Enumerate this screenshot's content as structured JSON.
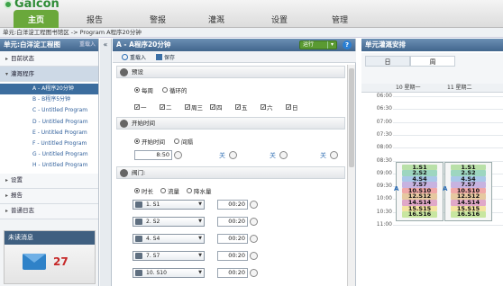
{
  "app": {
    "logo": "Galcon",
    "breadcrumb": "单元:白洋淀工程图书馆区 -> Program A程序20分钟"
  },
  "nav": [
    "主页",
    "报告",
    "警报",
    "灌溉",
    "设置",
    "管理"
  ],
  "sidebar": {
    "title": "单元:白洋淀工程图",
    "title_action": "重载入",
    "items_top": [
      {
        "label": "目前状态"
      },
      {
        "label": "灌溉程序"
      }
    ],
    "programs": [
      "A - A程序20分钟",
      "B - B程序5分钟",
      "C - Untitled Program",
      "D - Untitled Program",
      "E - Untitled Program",
      "F - Untitled Program",
      "G - Untitled Program",
      "H - Untitled Program"
    ],
    "items_bottom": [
      {
        "label": "设置"
      },
      {
        "label": "报告"
      },
      {
        "label": "普通日志"
      }
    ],
    "messages_title": "未读消息",
    "messages_count": "27"
  },
  "collapse": "«",
  "program": {
    "title": "A - A程序20分钟",
    "run_label": "运行",
    "reload": "重载入",
    "save": "保存",
    "schedule_title": "预设",
    "every_week": "每周",
    "cyclic": "循环的",
    "days": [
      "一",
      "二",
      "周三",
      "四",
      "五",
      "六",
      "日"
    ],
    "start_title": "开始时间",
    "start_time_opt": "开始时间",
    "interval_opt": "间隔",
    "start_value": "8:50",
    "off1": "关",
    "off2": "关",
    "off3": "关",
    "valves_title": "阀门:",
    "dur_opt": "时长",
    "flow_opt": "流量",
    "rain_opt": "降水量",
    "valves": [
      {
        "name": "1. S1",
        "duration": "00:20"
      },
      {
        "name": "2. S2",
        "duration": "00:20"
      },
      {
        "name": "4. S4",
        "duration": "00:20"
      },
      {
        "name": "7. S7",
        "duration": "00:20"
      },
      {
        "name": "10. S10",
        "duration": "00:20"
      }
    ]
  },
  "schedule": {
    "title": "单元灌溉安排",
    "tabs": [
      "日",
      "周"
    ],
    "days": [
      "10 星期一",
      "11 星期二"
    ],
    "times": [
      "06:00",
      "06:30",
      "07:00",
      "07:30",
      "08:00",
      "08:30",
      "09:00",
      "09:30",
      "10:00",
      "10:30",
      "11:00"
    ],
    "program_letter": "A",
    "stations": [
      "1.S1",
      "2.S2",
      "4.S4",
      "7.S7",
      "10.S10",
      "12.S12",
      "14.S14",
      "15.S15",
      "16.S16"
    ],
    "station_colors": [
      "#b9e0a8",
      "#9dd6c0",
      "#a9c7e8",
      "#c7b3e0",
      "#f0a8a8",
      "#e6c8a0",
      "#e0a8c8",
      "#f3e3a0",
      "#c8e6a0"
    ]
  }
}
